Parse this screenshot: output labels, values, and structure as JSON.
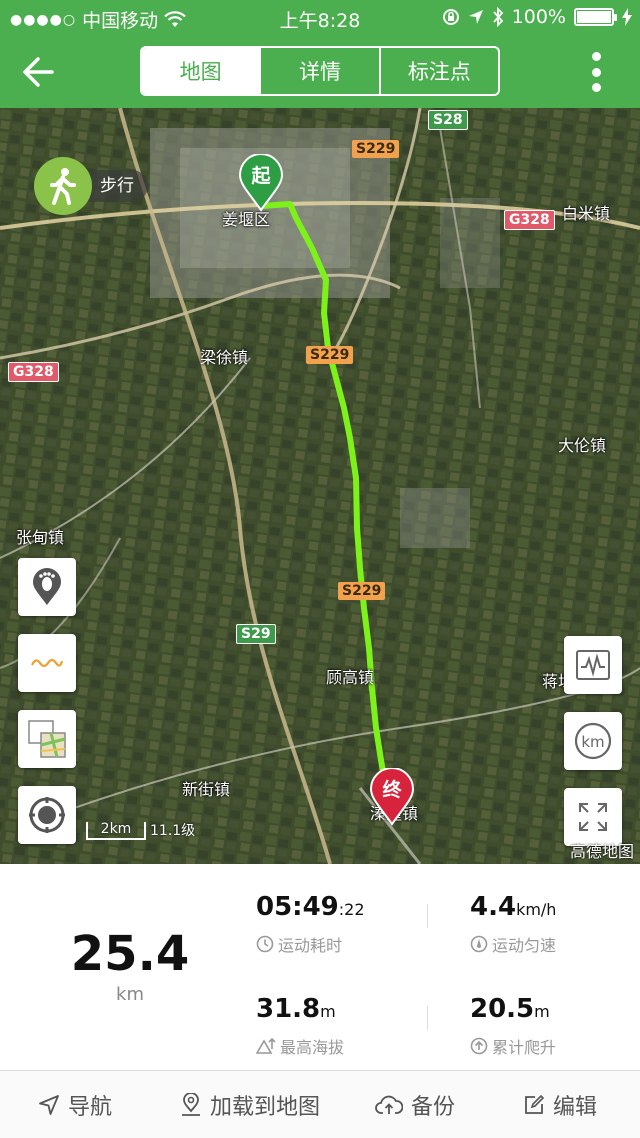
{
  "status_bar": {
    "carrier": "中国移动",
    "time": "上午8:28",
    "battery": "100%",
    "battery_level": 1.0
  },
  "nav": {
    "tabs": [
      {
        "label": "地图",
        "active": true
      },
      {
        "label": "详情",
        "active": false
      },
      {
        "label": "标注点",
        "active": false
      }
    ]
  },
  "map": {
    "mode_label": "步行",
    "start_pin": "起",
    "end_pin": "终",
    "places": [
      "姜堰区",
      "梁徐镇",
      "白米镇",
      "大伦镇",
      "张甸镇",
      "顾高镇",
      "新街镇",
      "蒋垛",
      "溱潼镇"
    ],
    "road_signs": [
      "S28",
      "S229",
      "G328",
      "G328",
      "S229",
      "S229",
      "S29"
    ],
    "scale_text": "2km",
    "zoom_level": "11.1级",
    "provider": "高德地图",
    "track_color": "#7cf21a"
  },
  "stats": {
    "distance": "25.4",
    "distance_unit": "km",
    "duration_main": "05:49",
    "duration_sec": ":22",
    "duration_label": "运动耗时",
    "speed": "4.4",
    "speed_unit": "km/h",
    "speed_label": "运动匀速",
    "max_alt": "31.8",
    "max_alt_unit": "m",
    "max_alt_label": "最高海拔",
    "climb": "20.5",
    "climb_unit": "m",
    "climb_label": "累计爬升"
  },
  "bottom_bar": {
    "navigate": "导航",
    "load_to_map": "加载到地图",
    "backup": "备份",
    "edit": "编辑"
  }
}
